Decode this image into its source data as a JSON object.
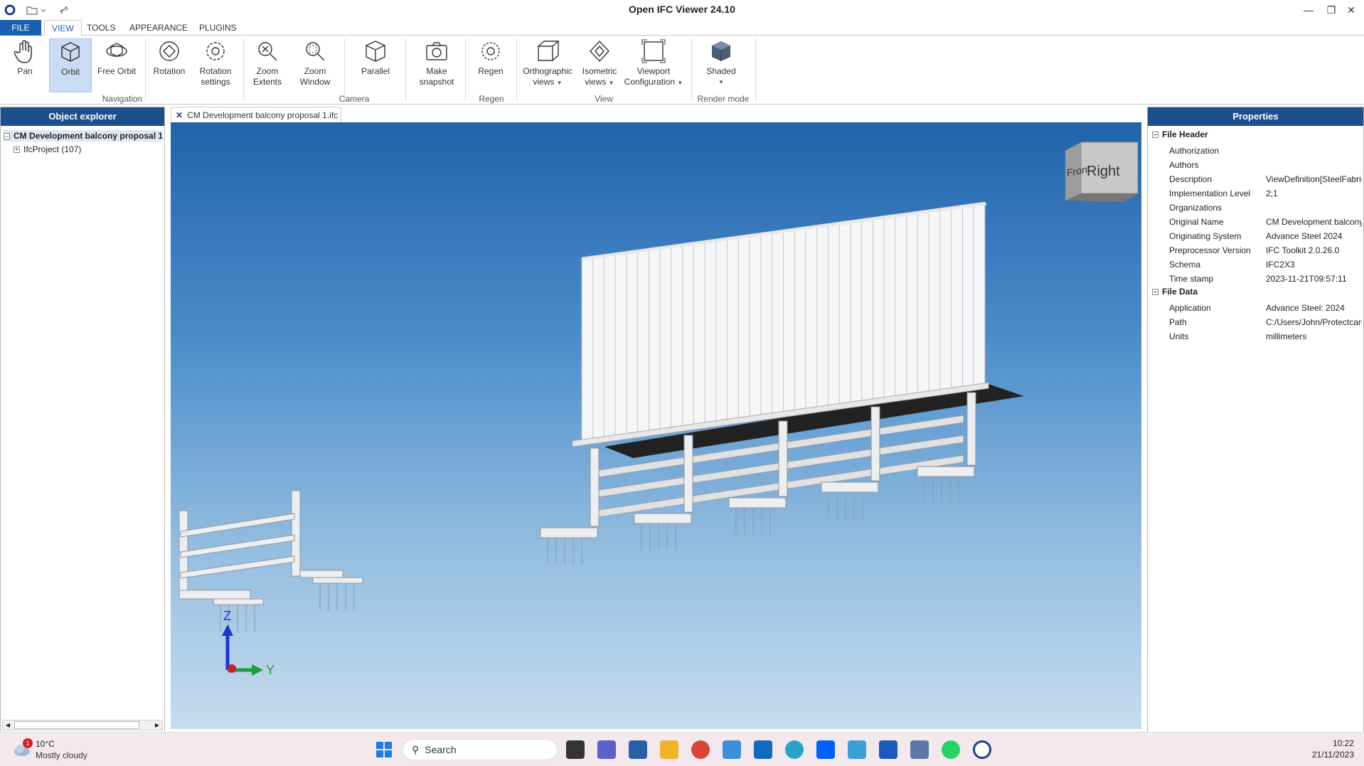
{
  "titlebar": {
    "title": "Open IFC Viewer 24.10"
  },
  "menu": {
    "file": "FILE",
    "view": "VIEW",
    "tools": "TOOLS",
    "appearance": "APPEARANCE",
    "plugins": "PLUGINS"
  },
  "ribbon": {
    "pan": "Pan",
    "orbit": "Orbit",
    "free_orbit": "Free Orbit",
    "rotation": "Rotation",
    "rotation_settings_1": "Rotation",
    "rotation_settings_2": "settings",
    "zoom_extents_1": "Zoom",
    "zoom_extents_2": "Extents",
    "zoom_window_1": "Zoom",
    "zoom_window_2": "Window",
    "parallel": "Parallel",
    "make_snapshot_1": "Make",
    "make_snapshot_2": "snapshot",
    "regen": "Regen",
    "ortho_1": "Orthographic",
    "ortho_2": "views",
    "iso_1": "Isometric",
    "iso_2": "views",
    "viewport_1": "Viewport",
    "viewport_2": "Configuration",
    "shaded": "Shaded",
    "groups": {
      "navigation": "Navigation",
      "camera": "Camera",
      "regen": "Regen",
      "view": "View",
      "render_mode": "Render mode"
    }
  },
  "object_explorer": {
    "title": "Object explorer",
    "root": "CM Development balcony proposal 1",
    "child": "IfcProject (107)"
  },
  "document_tab": {
    "label": "CM Development balcony proposal 1.ifc"
  },
  "viewport": {
    "cube_front": "Front",
    "cube_right": "Right",
    "axis_z": "Z",
    "axis_y": "Y"
  },
  "properties": {
    "title": "Properties",
    "file_header": {
      "label": "File Header",
      "rows": [
        {
          "k": "Authorization",
          "v": ""
        },
        {
          "k": "Authors",
          "v": ""
        },
        {
          "k": "Description",
          "v": "ViewDefinition[SteelFabric"
        },
        {
          "k": "Implementation Level",
          "v": "2;1"
        },
        {
          "k": "Organizations",
          "v": ""
        },
        {
          "k": "Original Name",
          "v": "CM Development balcony"
        },
        {
          "k": "Originating System",
          "v": "Advance Steel 2024"
        },
        {
          "k": "Preprocessor Version",
          "v": "IFC Toolkit 2.0.26.0"
        },
        {
          "k": "Schema",
          "v": "IFC2X3"
        },
        {
          "k": "Time stamp",
          "v": "2023-11-21T09:57:11"
        }
      ]
    },
    "file_data": {
      "label": "File Data",
      "rows": [
        {
          "k": "Application",
          "v": "Advance Steel: 2024"
        },
        {
          "k": "Path",
          "v": "C:/Users/John/Protectcare"
        },
        {
          "k": "Units",
          "v": "millimeters"
        }
      ]
    }
  },
  "taskbar": {
    "weather_temp": "10°C",
    "weather_desc": "Mostly cloudy",
    "weather_badge": "1",
    "search": "Search",
    "time": "10:22",
    "date": "21/11/2023"
  }
}
